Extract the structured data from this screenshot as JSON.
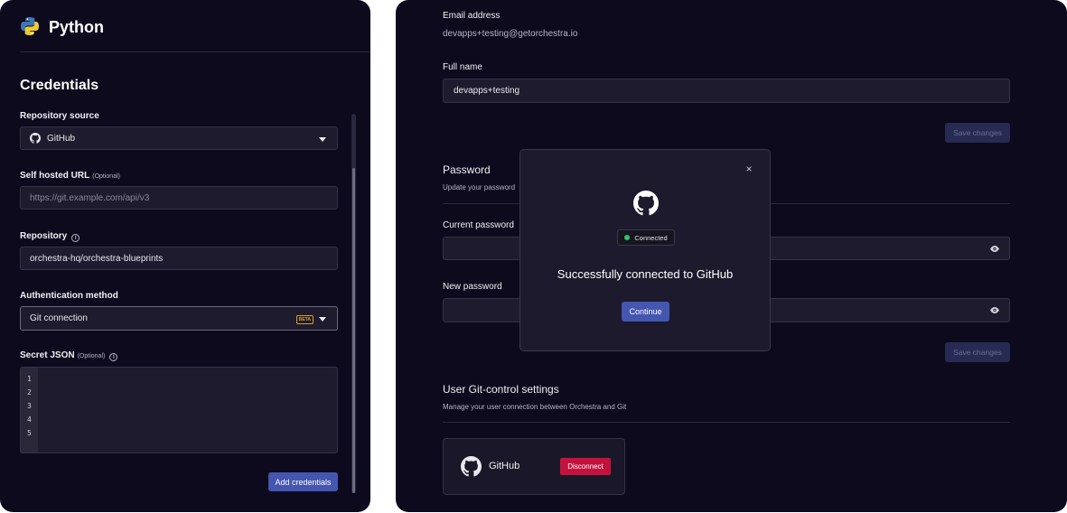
{
  "left": {
    "title": "Python",
    "section_title": "Credentials",
    "repository_source": {
      "label": "Repository source",
      "value": "GitHub"
    },
    "self_hosted_url": {
      "label": "Self hosted URL",
      "optional": "(Optional)",
      "placeholder": "https://git.example.com/api/v3"
    },
    "repository": {
      "label": "Repository",
      "value": "orchestra-hq/orchestra-blueprints"
    },
    "auth_method": {
      "label": "Authentication method",
      "value": "Git connection",
      "badge": "BETA"
    },
    "secret_json": {
      "label": "Secret JSON",
      "optional": "(Optional)",
      "line_numbers": [
        "1",
        "2",
        "3",
        "4",
        "5"
      ]
    },
    "add_button": "Add credentials"
  },
  "right": {
    "email_label": "Email address",
    "email_value": "devapps+testing@getorchestra.io",
    "fullname_label": "Full name",
    "fullname_value": "devapps+testing",
    "save_label": "Save changes",
    "password_title": "Password",
    "password_sub": "Update your password",
    "current_password_label": "Current password",
    "new_password_label": "New password",
    "git_title": "User Git-control settings",
    "git_sub": "Manage your user connection between Orchestra and Git",
    "github_label": "GitHub",
    "disconnect_label": "Disconnect"
  },
  "modal": {
    "badge": "Connected",
    "title": "Successfully connected to GitHub",
    "continue": "Continue",
    "close": "×"
  },
  "colors": {
    "background": "#0c0a1c",
    "primary": "#4456b0",
    "danger": "#c4123c",
    "success": "#2ec46a",
    "beta": "#d8a02a"
  }
}
